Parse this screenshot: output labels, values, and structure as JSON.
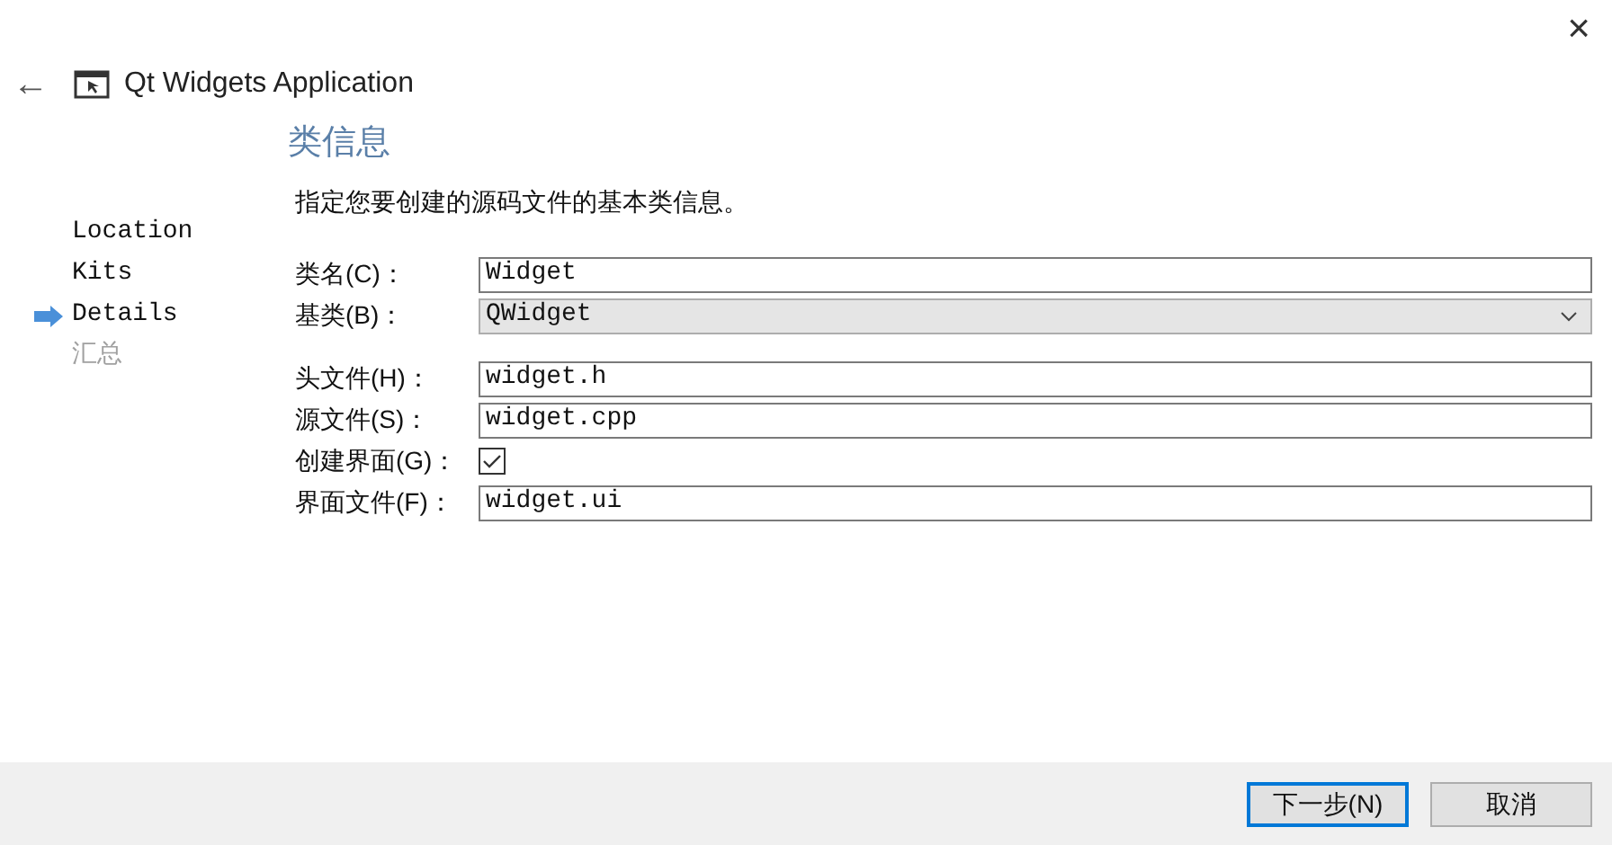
{
  "window": {
    "title": "Qt Widgets Application",
    "close": "×",
    "back": "←"
  },
  "steps": [
    {
      "label": "Location",
      "selected": false,
      "disabled": false
    },
    {
      "label": "Kits",
      "selected": false,
      "disabled": false
    },
    {
      "label": "Details",
      "selected": true,
      "disabled": false
    },
    {
      "label": "汇总",
      "selected": false,
      "disabled": true
    }
  ],
  "page": {
    "heading": "类信息",
    "description": "指定您要创建的源码文件的基本类信息。"
  },
  "fields": [
    {
      "kind": "text",
      "label": "类名(C)：",
      "value": "Widget"
    },
    {
      "kind": "combo",
      "label": "基类(B)：",
      "value": "QWidget"
    },
    {
      "kind": "gap"
    },
    {
      "kind": "text",
      "label": "头文件(H)：",
      "value": "widget.h"
    },
    {
      "kind": "text",
      "label": "源文件(S)：",
      "value": "widget.cpp"
    },
    {
      "kind": "checkbox",
      "label": "创建界面(G)：",
      "checked": true
    },
    {
      "kind": "text",
      "label": "界面文件(F)：",
      "value": "widget.ui"
    }
  ],
  "buttons": [
    {
      "label": "下一步(N)",
      "default": true
    },
    {
      "label": "取消",
      "default": false
    }
  ]
}
